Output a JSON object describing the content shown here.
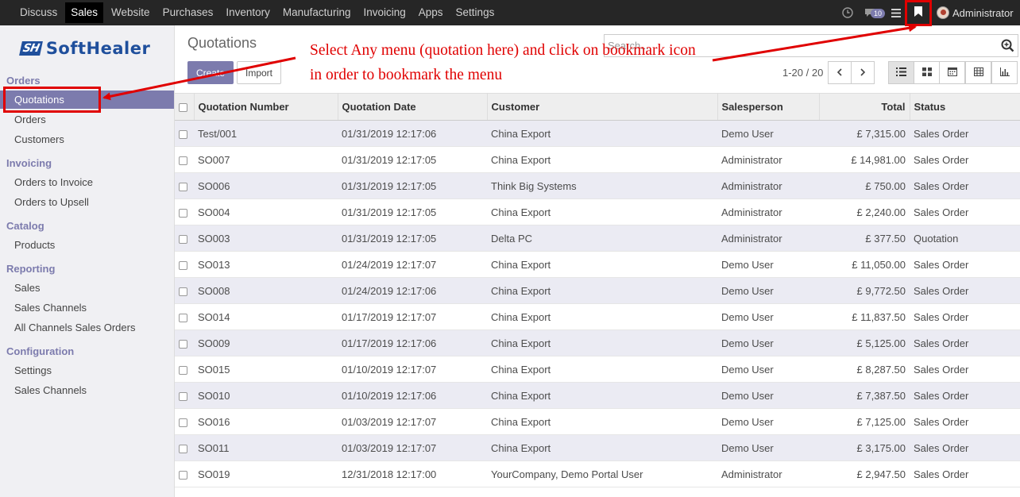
{
  "topbar": {
    "apps": [
      "Discuss",
      "Sales",
      "Website",
      "Purchases",
      "Inventory",
      "Manufacturing",
      "Invoicing",
      "Apps",
      "Settings"
    ],
    "active_app": "Sales",
    "chat_count": "10",
    "user_name": "Administrator"
  },
  "brand": {
    "mark": "SH",
    "name": "SoftHealer"
  },
  "sidebar": {
    "sections": [
      {
        "title": "Orders",
        "items": [
          "Quotations",
          "Orders",
          "Customers"
        ]
      },
      {
        "title": "Invoicing",
        "items": [
          "Orders to Invoice",
          "Orders to Upsell"
        ]
      },
      {
        "title": "Catalog",
        "items": [
          "Products"
        ]
      },
      {
        "title": "Reporting",
        "items": [
          "Sales",
          "Sales Channels",
          "All Channels Sales Orders"
        ]
      },
      {
        "title": "Configuration",
        "items": [
          "Settings",
          "Sales Channels"
        ]
      }
    ],
    "active_item": "Quotations"
  },
  "page": {
    "title": "Quotations",
    "create_label": "Create",
    "import_label": "Import",
    "search_placeholder": "Search...",
    "pager": "1-20 / 20"
  },
  "annotation": {
    "line1": "Select Any menu (quotation here) and click on bookmark icon",
    "line2": "in order to bookmark the menu",
    "color": "#e00000"
  },
  "table": {
    "columns": [
      "Quotation Number",
      "Quotation Date",
      "Customer",
      "Salesperson",
      "Total",
      "Status"
    ],
    "rows": [
      [
        "Test/001",
        "01/31/2019 12:17:06",
        "China Export",
        "Demo User",
        "£ 7,315.00",
        "Sales Order"
      ],
      [
        "SO007",
        "01/31/2019 12:17:05",
        "China Export",
        "Administrator",
        "£ 14,981.00",
        "Sales Order"
      ],
      [
        "SO006",
        "01/31/2019 12:17:05",
        "Think Big Systems",
        "Administrator",
        "£ 750.00",
        "Sales Order"
      ],
      [
        "SO004",
        "01/31/2019 12:17:05",
        "China Export",
        "Administrator",
        "£ 2,240.00",
        "Sales Order"
      ],
      [
        "SO003",
        "01/31/2019 12:17:05",
        "Delta PC",
        "Administrator",
        "£ 377.50",
        "Quotation"
      ],
      [
        "SO013",
        "01/24/2019 12:17:07",
        "China Export",
        "Demo User",
        "£ 11,050.00",
        "Sales Order"
      ],
      [
        "SO008",
        "01/24/2019 12:17:06",
        "China Export",
        "Demo User",
        "£ 9,772.50",
        "Sales Order"
      ],
      [
        "SO014",
        "01/17/2019 12:17:07",
        "China Export",
        "Demo User",
        "£ 11,837.50",
        "Sales Order"
      ],
      [
        "SO009",
        "01/17/2019 12:17:06",
        "China Export",
        "Demo User",
        "£ 5,125.00",
        "Sales Order"
      ],
      [
        "SO015",
        "01/10/2019 12:17:07",
        "China Export",
        "Demo User",
        "£ 8,287.50",
        "Sales Order"
      ],
      [
        "SO010",
        "01/10/2019 12:17:06",
        "China Export",
        "Demo User",
        "£ 7,387.50",
        "Sales Order"
      ],
      [
        "SO016",
        "01/03/2019 12:17:07",
        "China Export",
        "Demo User",
        "£ 7,125.00",
        "Sales Order"
      ],
      [
        "SO011",
        "01/03/2019 12:17:07",
        "China Export",
        "Demo User",
        "£ 3,175.00",
        "Sales Order"
      ],
      [
        "SO019",
        "12/31/2018 12:17:00",
        "YourCompany, Demo Portal User",
        "Administrator",
        "£ 2,947.50",
        "Sales Order"
      ]
    ]
  }
}
